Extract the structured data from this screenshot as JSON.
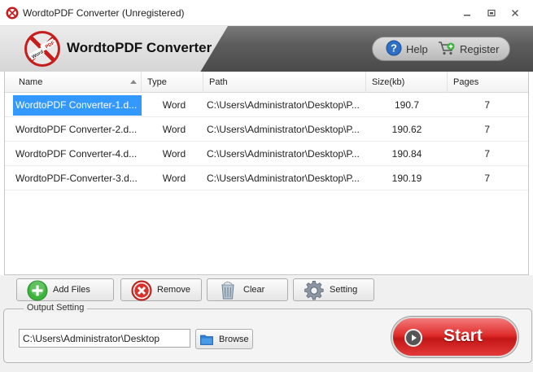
{
  "window": {
    "title": "WordtoPDF Converter (Unregistered)",
    "controls": [
      "minimize-icon",
      "maximize-icon",
      "close-icon"
    ]
  },
  "header": {
    "logo_text_top": "Word",
    "logo_text_bottom": "PDF",
    "app_title": "WordtoPDF Converter",
    "help_label": "Help",
    "register_label": "Register"
  },
  "table": {
    "columns": [
      "Name",
      "Type",
      "Path",
      "Size(kb)",
      "Pages"
    ],
    "sort_column": "Name",
    "rows": [
      {
        "name": "WordtoPDF Converter-1.d...",
        "type": "Word",
        "path": "C:\\Users\\Administrator\\Desktop\\P...",
        "size": "190.7",
        "pages": "7",
        "selected": true
      },
      {
        "name": "WordtoPDF Converter-2.d...",
        "type": "Word",
        "path": "C:\\Users\\Administrator\\Desktop\\P...",
        "size": "190.62",
        "pages": "7",
        "selected": false
      },
      {
        "name": "WordtoPDF Converter-4.d...",
        "type": "Word",
        "path": "C:\\Users\\Administrator\\Desktop\\P...",
        "size": "190.84",
        "pages": "7",
        "selected": false
      },
      {
        "name": "WordtoPDF-Converter-3.d...",
        "type": "Word",
        "path": "C:\\Users\\Administrator\\Desktop\\P...",
        "size": "190.19",
        "pages": "7",
        "selected": false
      }
    ]
  },
  "toolbar": {
    "add_files": "Add Files",
    "remove": "Remove",
    "clear": "Clear",
    "setting": "Setting"
  },
  "output": {
    "group_label": "Output Setting",
    "path_value": "C:\\Users\\Administrator\\Desktop",
    "browse_label": "Browse"
  },
  "start": {
    "label": "Start"
  },
  "colors": {
    "selection": "#3399ff",
    "start_red": "#e02d2d",
    "add_green": "#3cb43c",
    "remove_red": "#d9312b",
    "help_blue": "#2d6fc7"
  }
}
